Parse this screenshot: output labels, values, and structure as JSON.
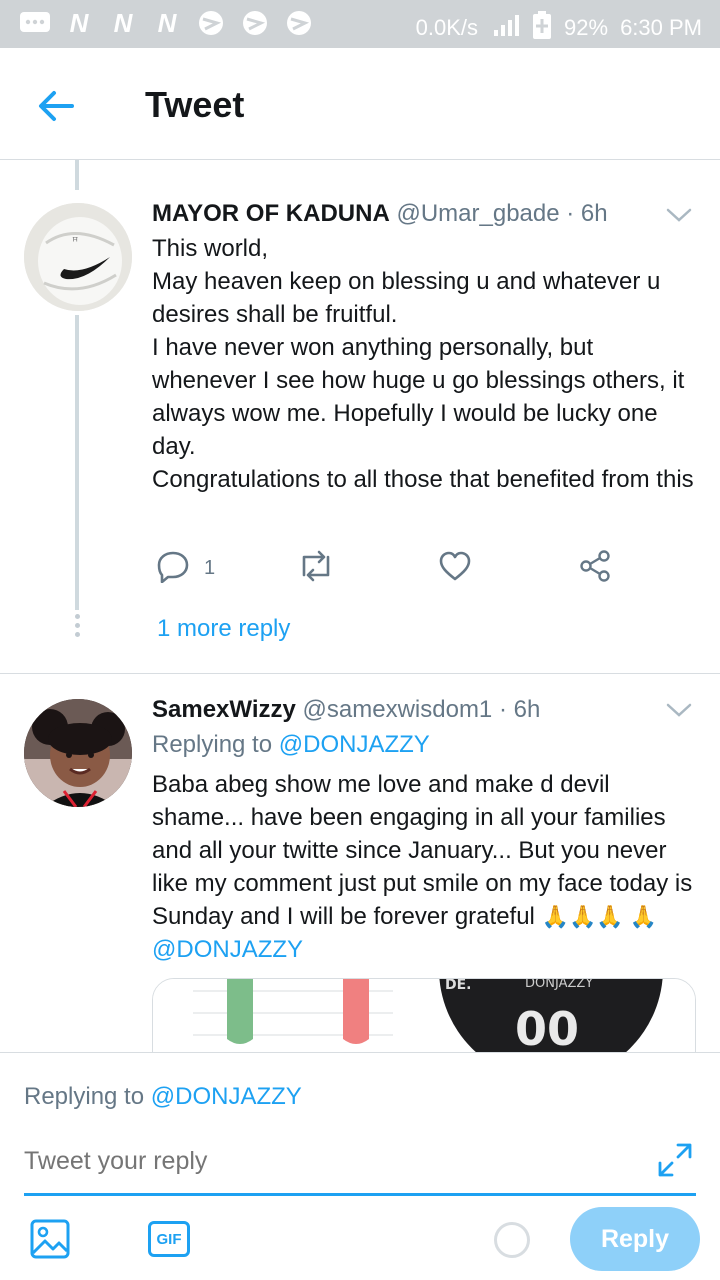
{
  "status_bar": {
    "left_icons": [
      "chat-icon",
      "n-icon",
      "n-icon",
      "n-icon",
      "sports-icon",
      "sports-icon",
      "sports-icon"
    ],
    "speed": "0.0K/s",
    "battery": "92%",
    "time": "6:30 PM"
  },
  "header": {
    "title": "Tweet"
  },
  "tweets": [
    {
      "name": "MAYOR OF KADUNA",
      "handle": "@Umar_gbade",
      "time": "· 6h",
      "lines": [
        "This world,",
        "May heaven keep on blessing u and whatever u desires shall be fruitful.",
        "I have never won anything personally, but whenever I see how huge u go blessings others, it always wow me. Hopefully I would be lucky one day.",
        "Congratulations to all those that benefited from this"
      ],
      "reply_count": "1",
      "more_reply": "1 more reply"
    },
    {
      "name": "SamexWizzy",
      "handle": "@samexwisdom1",
      "time": "· 6h",
      "replying_label": "Replying to",
      "replying_to": "@DONJAZZY",
      "text": "Baba abeg show me love and make d devil shame... have been engaging in all your families and all your twitte since January... But you never like my comment just put smile on my face today is Sunday and I will be forever grateful",
      "emoji": "🙏🙏🙏 🙏",
      "mention": "@DONJAZZY",
      "card_text": "DONJAZZY"
    }
  ],
  "composer": {
    "replying_label": "Replying to",
    "replying_to": "@DONJAZZY",
    "placeholder": "Tweet your reply",
    "reply_button": "Reply"
  },
  "colors": {
    "accent": "#1da1f2",
    "muted": "#657786",
    "button_disabled": "#8ed0f9"
  }
}
